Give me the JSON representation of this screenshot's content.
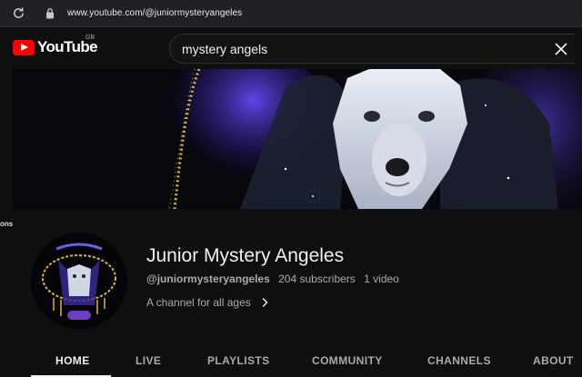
{
  "browser": {
    "url": "www.youtube.com/@juniormysteryangeles"
  },
  "header": {
    "logo_text": "YouTube",
    "region": "GB"
  },
  "search": {
    "query": "mystery angels"
  },
  "side_label": "ons",
  "channel": {
    "name": "Junior Mystery Angeles",
    "handle": "@juniormysteryangeles",
    "subscribers": "204 subscribers",
    "videos": "1 video",
    "description": "A channel for all ages"
  },
  "tabs": [
    {
      "label": "HOME",
      "active": true
    },
    {
      "label": "LIVE",
      "active": false
    },
    {
      "label": "PLAYLISTS",
      "active": false
    },
    {
      "label": "COMMUNITY",
      "active": false
    },
    {
      "label": "CHANNELS",
      "active": false
    },
    {
      "label": "ABOUT",
      "active": false
    }
  ],
  "colors": {
    "brand_red": "#ff0000",
    "background": "#0f0f0f",
    "muted_text": "#aaaaaa"
  }
}
